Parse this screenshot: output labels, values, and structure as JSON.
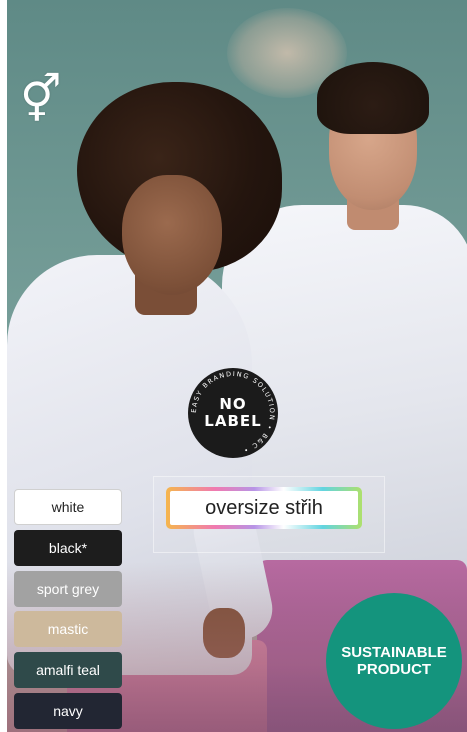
{
  "gender_symbol": "⚥",
  "badge": {
    "main_line1": "NO",
    "main_line2": "LABEL",
    "ring_text": "EASY BRANDING SOLUTION • B&C •"
  },
  "feature_label": "oversize střih",
  "colors": [
    {
      "label": "white",
      "bg": "#ffffff",
      "fg": "#222222"
    },
    {
      "label": "black*",
      "bg": "#1d1d1d",
      "fg": "#ffffff"
    },
    {
      "label": "sport grey",
      "bg": "#a2a2a2",
      "fg": "#ffffff"
    },
    {
      "label": "mastic",
      "bg": "#cdb99c",
      "fg": "#ffffff"
    },
    {
      "label": "amalfi teal",
      "bg": "#2f4a4a",
      "fg": "#ffffff"
    },
    {
      "label": "navy",
      "bg": "#222633",
      "fg": "#ffffff"
    }
  ],
  "sustainable": {
    "line1": "SUSTAINABLE",
    "line2": "PRODUCT",
    "color": "#14947d"
  }
}
